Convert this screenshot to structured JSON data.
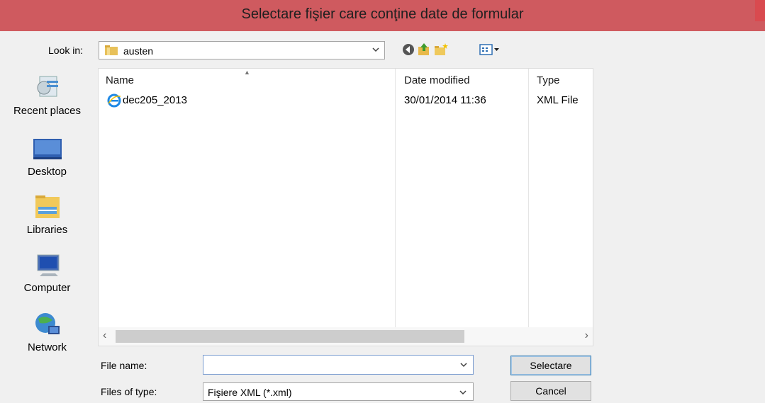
{
  "window": {
    "title": "Selectare fişier care conţine date de formular"
  },
  "lookin": {
    "label": "Look in:",
    "value": "austen"
  },
  "places": [
    {
      "label": "Recent places",
      "icon": "recent-places-icon"
    },
    {
      "label": "Desktop",
      "icon": "desktop-icon"
    },
    {
      "label": "Libraries",
      "icon": "libraries-icon"
    },
    {
      "label": "Computer",
      "icon": "computer-icon"
    },
    {
      "label": "Network",
      "icon": "network-icon"
    }
  ],
  "list": {
    "columns": [
      "Name",
      "Date modified",
      "Type"
    ],
    "rows": [
      {
        "name": "dec205_2013",
        "date": "30/01/2014 11:36",
        "type": "XML File"
      }
    ]
  },
  "filename": {
    "label": "File name:",
    "value": ""
  },
  "filetype": {
    "label": "Files of type:",
    "value": "Fişiere XML (*.xml)"
  },
  "buttons": {
    "select": "Selectare",
    "cancel": "Cancel"
  },
  "colors": {
    "titlebar": "#cf5a5f",
    "background": "#f0f0f0"
  }
}
